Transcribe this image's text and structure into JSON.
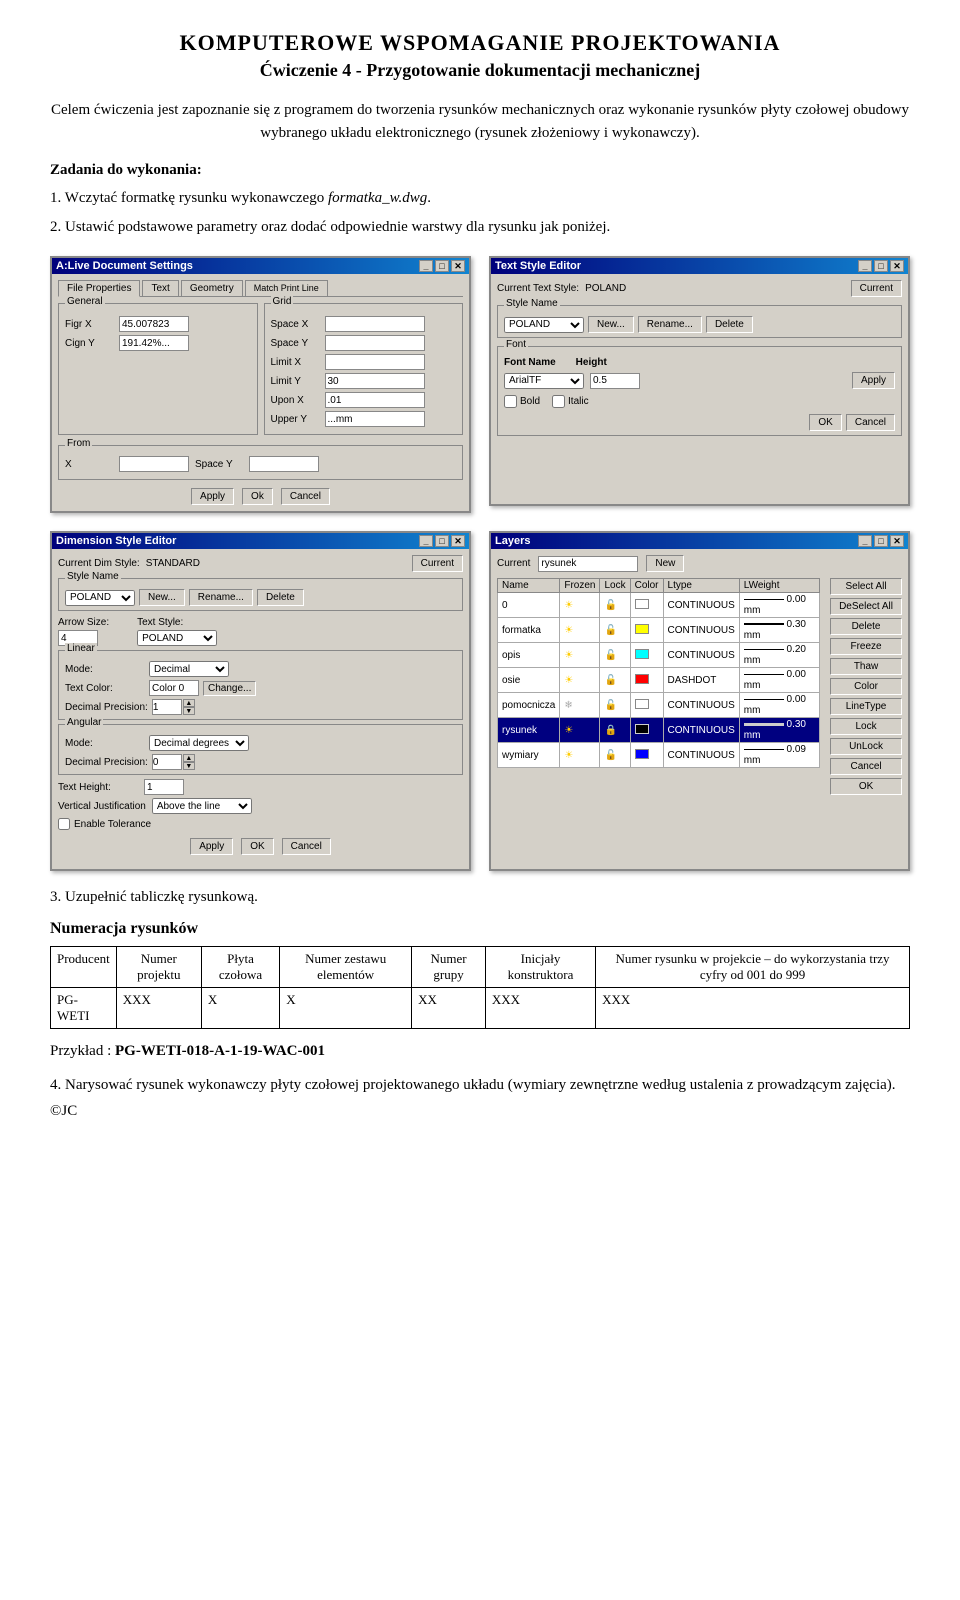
{
  "page": {
    "main_title": "KOMPUTEROWE WSPOMAGANIE PROJEKTOWANIA",
    "sub_title": "Ćwiczenie 4 - Przygotowanie dokumentacji mechanicznej",
    "intro": "Celem ćwiczenia jest zapoznanie się z programem do tworzenia rysunków mechanicznych oraz wykonanie rysunków płyty czołowej obudowy wybranego układu elektronicznego (rysunek złożeniowy i wykonawczy).",
    "zadania_title": "Zadania do wykonania:",
    "item1_prefix": "1. Wczytać formatkę rysunku wykonawczego ",
    "item1_italic": "formatka_w.dwg",
    "item1_suffix": ".",
    "item2": "2. Ustawić podstawowe parametry oraz dodać odpowiednie warstwy dla rysunku jak poniżej.",
    "section3": "3. Uzupełnić tabliczkę rysunkową.",
    "num_section_title": "Numeracja rysunków",
    "item4": "4. Narysować rysunek wykonawczy płyty czołowej projektowanego układu (wymiary zewnętrzne według ustalenia z prowadzącym zajęcia).",
    "copyright": "©JC"
  },
  "dialog_drawing_settings": {
    "title": "A:Live Document Settings",
    "tabs": [
      "File Properties",
      "Text",
      "Geometry",
      "Match Print Line"
    ],
    "group_general": "General",
    "rows_general": [
      {
        "label": "Figr X",
        "value": "45.007823"
      },
      {
        "label": "Cign Y",
        "value": "191.42%..."
      }
    ],
    "group_grid": "Grid",
    "rows_grid": [
      {
        "label": "Space X",
        "value": ""
      },
      {
        "label": "Space Y",
        "value": ""
      },
      {
        "label": "Limit X",
        "value": ""
      },
      {
        "label": "Limit Y",
        "value": "30"
      },
      {
        "label": "Upon X",
        "value": ".01"
      },
      {
        "label": "Upper Y",
        "value": "...mm"
      }
    ],
    "group_from": "From",
    "rows_from": [
      {
        "label": "X",
        "value": ""
      },
      {
        "label": "Space Y",
        "value": ""
      }
    ],
    "buttons": [
      "Apply",
      "Ok",
      "Cancel"
    ]
  },
  "dialog_text_style": {
    "title": "Text Style Editor",
    "current_label": "Current Text Style:",
    "current_value": "POLAND",
    "current_btn": "Current",
    "group_style": "Style Name",
    "style_value": "POLAND",
    "btns_style": [
      "New...",
      "Rename...",
      "Delete"
    ],
    "group_font": "Font",
    "font_name_label": "Font Name",
    "font_height_label": "Height",
    "font_name_value": "ArialTF",
    "font_height_value": "0.5",
    "font_apply_btn": "Apply",
    "font_ok_btn": "OK",
    "font_cancel_btn": "Cancel",
    "check_bold": "Bold",
    "check_italic": "Italic"
  },
  "dialog_dim_style": {
    "title": "Dimension Style Editor",
    "current_label": "Current Dim Style:",
    "current_value": "STANDARD",
    "current_btn": "Current",
    "group_style": "Style Name",
    "style_value": "POLAND",
    "btns_style": [
      "New...",
      "Rename...",
      "Delete"
    ],
    "arrow_size_label": "Arrow Size:",
    "arrow_size_value": "4",
    "text_style_label": "Text Style:",
    "text_style_value": "POLAND",
    "group_linear": "Linear",
    "mode_label": "Mode:",
    "mode_value": "Decimal",
    "text_color_label": "Text Color:",
    "text_color_value": "Color 0",
    "text_color_btn": "Change...",
    "dec_prec_label": "Decimal Precision:",
    "dec_prec_value": "1",
    "group_angular": "Angular",
    "ang_mode_label": "Mode:",
    "ang_mode_value": "Decimal degrees",
    "ang_dec_prec_label": "Decimal Precision:",
    "ang_dec_prec_value": "0",
    "text_height_label": "Text Height:",
    "text_height_value": "1",
    "vert_just_label": "Vertical Justification",
    "vert_just_value": "Above the line",
    "check_enable_tol": "Enable Tolerance",
    "btns_bottom": [
      "Apply",
      "OK",
      "Cancel"
    ]
  },
  "dialog_layers": {
    "title": "Layers",
    "current_label": "Current",
    "current_value": "rysunek",
    "new_btn": "New",
    "columns": [
      "Name",
      "Frozen",
      "Lock",
      "Color",
      "Ltype",
      "LWeight"
    ],
    "rows": [
      {
        "name": "0",
        "frozen": "sun",
        "lock": "lock_open",
        "color": "white",
        "ltype": "CONTINUOUS",
        "lweight": "0.00 mm",
        "selected": false
      },
      {
        "name": "formatka",
        "frozen": "sun",
        "lock": "lock_open",
        "color": "yellow",
        "ltype": "CONTINUOUS",
        "lweight": "0.30 mm",
        "selected": false
      },
      {
        "name": "opis",
        "frozen": "sun",
        "lock": "lock_open",
        "color": "cyan",
        "ltype": "CONTINUOUS",
        "lweight": "0.20 mm",
        "selected": false
      },
      {
        "name": "osie",
        "frozen": "sun",
        "lock": "lock_open",
        "color": "red",
        "ltype": "DASHDOT",
        "lweight": "0.00 mm",
        "selected": false
      },
      {
        "name": "pomocnicza",
        "frozen": "sun_freeze",
        "lock": "lock_open",
        "color": "white",
        "ltype": "CONTINUOUS",
        "lweight": "0.00 mm",
        "selected": false
      },
      {
        "name": "rysunek",
        "frozen": "sun_yellow",
        "lock": "lock_yellow",
        "color": "black",
        "ltype": "CONTINUOUS",
        "lweight": "0.30 mm",
        "selected": true
      },
      {
        "name": "wymiary",
        "frozen": "sun",
        "lock": "lock_open",
        "color": "blue",
        "ltype": "CONTINUOUS",
        "lweight": "0.09 mm",
        "selected": false
      }
    ],
    "right_buttons": [
      "Select All",
      "DeSelect All",
      "Delete",
      "Freeze",
      "Thaw",
      "Color",
      "LineType",
      "Lock",
      "UnLock",
      "Cancel",
      "OK"
    ]
  },
  "num_table": {
    "headers": [
      "Producent",
      "Numer projektu",
      "Płyta czołowa",
      "Numer zestawu elementów",
      "Numer grupy",
      "Inicjały konstruktora",
      "Numer rysunku w projekcie – do wykorzystania trzy cyfry od 001 do 999"
    ],
    "row": [
      "PG-\nWETI",
      "XXX",
      "X",
      "X",
      "XX",
      "XXX",
      "XXX"
    ]
  },
  "example": {
    "prefix": "Przykład : ",
    "value": "PG-WETI-018-A-1-19-WAC-001",
    "bold": true
  }
}
